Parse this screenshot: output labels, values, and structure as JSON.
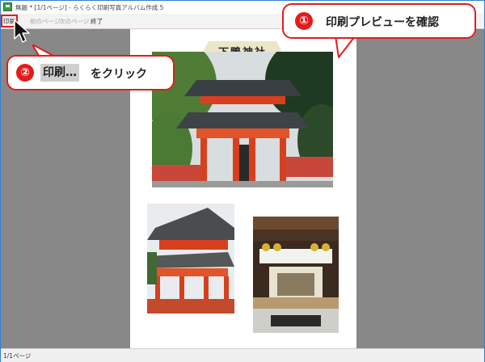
{
  "window": {
    "title": "無題 * [1/1ページ] - らくらく印刷写真アルバム作成 5"
  },
  "toolbar": {
    "print_label": "印刷",
    "prev_label": "前のページ",
    "next_label": "次のページ",
    "exit_label": "終了"
  },
  "page": {
    "shrine_title": "下鴨神社"
  },
  "statusbar": {
    "page_text": "1/1ページ"
  },
  "callouts": {
    "step1": {
      "number": "①",
      "text": "印刷プレビューを確認"
    },
    "step2": {
      "number": "②",
      "button_text": "印刷…",
      "text": "をクリック"
    }
  },
  "colors": {
    "accent": "#e51b1b",
    "workspace": "#888888",
    "shrine_vermilion": "#d7401e"
  },
  "icons": {
    "app": "app-icon",
    "cursor": "mouse-cursor-icon"
  }
}
